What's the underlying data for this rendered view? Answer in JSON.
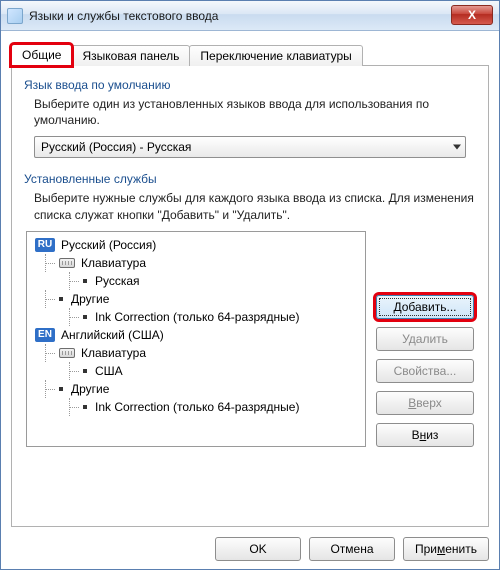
{
  "window": {
    "title": "Языки и службы текстового ввода",
    "close_glyph": "X"
  },
  "tabs": [
    {
      "label": "Общие",
      "active": true
    },
    {
      "label": "Языковая панель",
      "active": false
    },
    {
      "label": "Переключение клавиатуры",
      "active": false
    }
  ],
  "default_lang": {
    "title": "Язык ввода по умолчанию",
    "desc": "Выберите один из установленных языков ввода для использования по умолчанию.",
    "combo_value": "Русский (Россия) - Русская"
  },
  "installed": {
    "title": "Установленные службы",
    "desc": "Выберите нужные службы для каждого языка ввода из списка. Для изменения списка служат кнопки \"Добавить\" и \"Удалить\".",
    "tree": {
      "ru": {
        "badge": "RU",
        "lang": "Русский (Россия)",
        "keyboard_label": "Клавиатура",
        "keyboard_layout": "Русская",
        "other_label": "Другие",
        "other_item": "Ink Correction (только 64-разрядные)"
      },
      "en": {
        "badge": "EN",
        "lang": "Английский (США)",
        "keyboard_label": "Клавиатура",
        "keyboard_layout": "США",
        "other_label": "Другие",
        "other_item": "Ink Correction (только 64-разрядные)"
      }
    },
    "buttons": {
      "add": "Добавить...",
      "remove": "Удалить",
      "properties": "Свойства...",
      "up": "Вверх",
      "down": "Вниз"
    }
  },
  "dialog_buttons": {
    "ok": "OK",
    "cancel": "Отмена",
    "apply": "Применить"
  }
}
